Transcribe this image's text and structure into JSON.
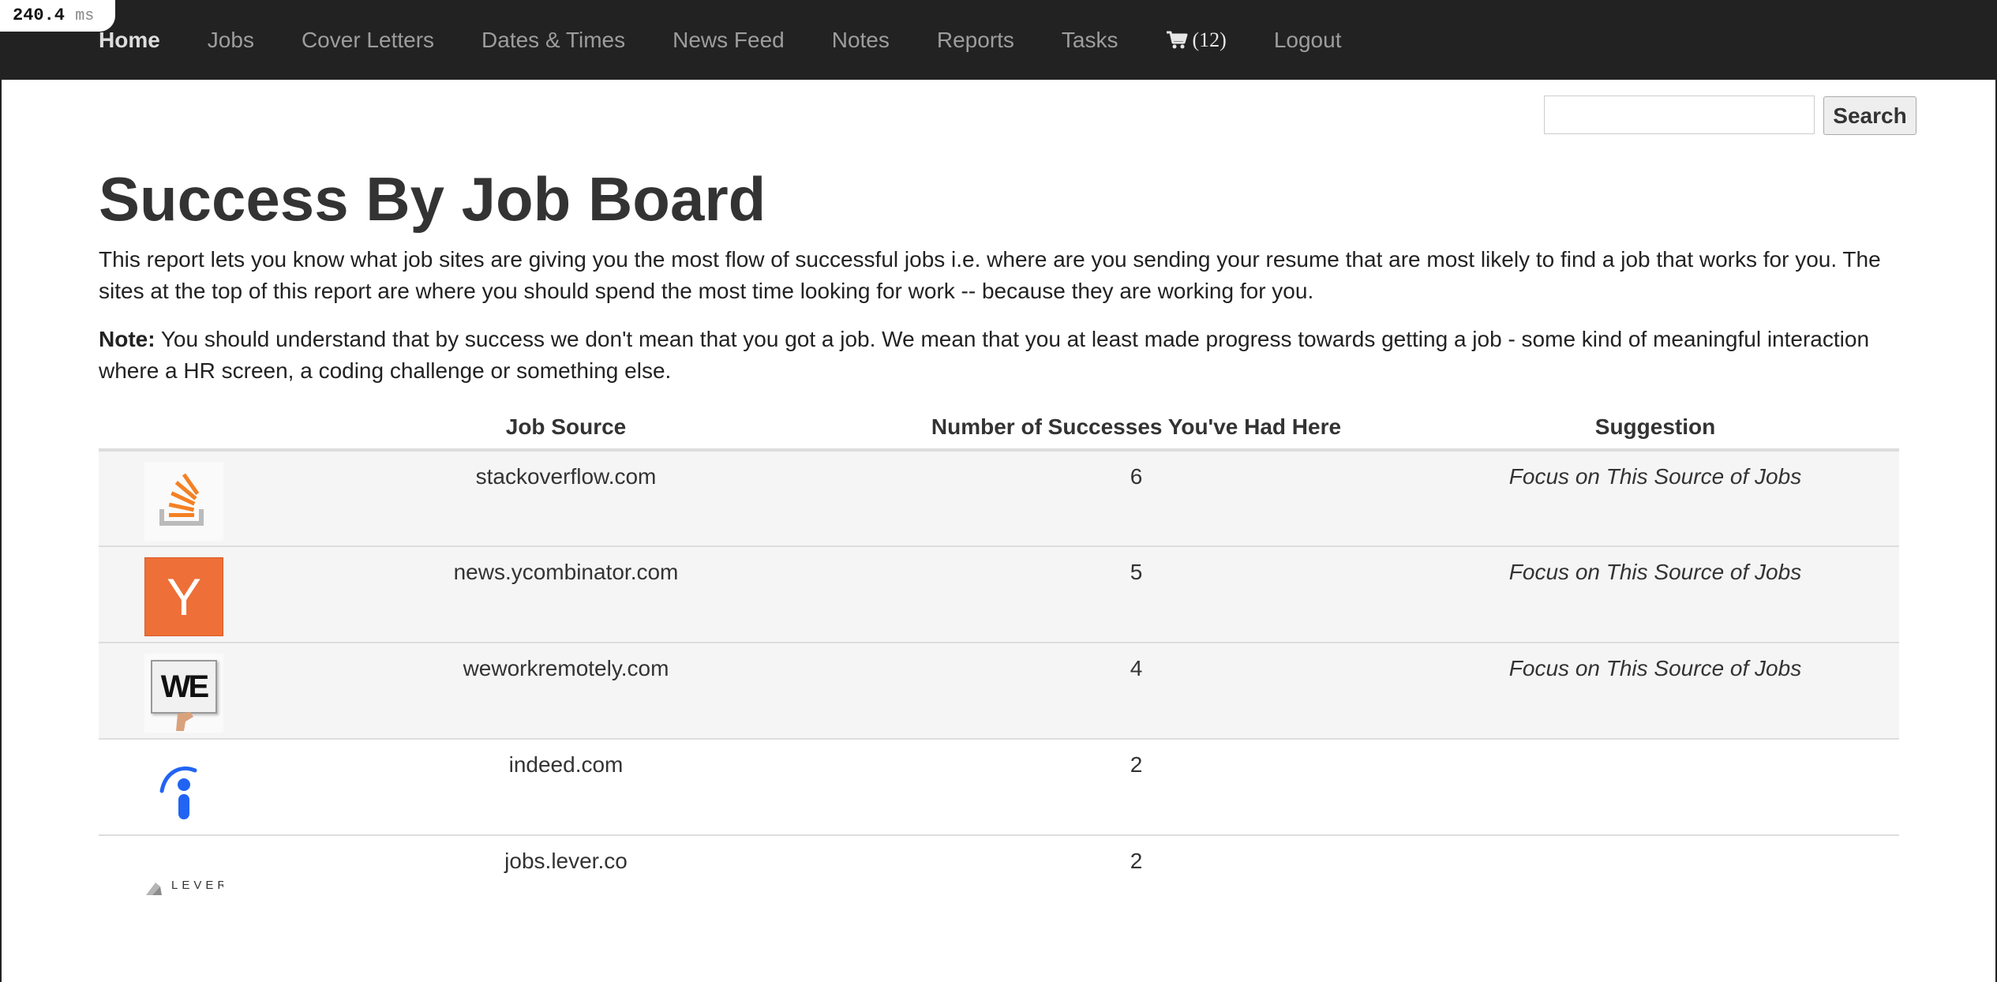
{
  "timing": {
    "value": "240.4",
    "unit": "ms"
  },
  "nav": {
    "items": [
      {
        "label": "Home",
        "active": true
      },
      {
        "label": "Jobs"
      },
      {
        "label": "Cover Letters"
      },
      {
        "label": "Dates & Times"
      },
      {
        "label": "News Feed"
      },
      {
        "label": "Notes"
      },
      {
        "label": "Reports"
      },
      {
        "label": "Tasks"
      }
    ],
    "cart": {
      "icon": "cart-icon",
      "count": "(12)"
    },
    "logout": "Logout"
  },
  "search": {
    "value": "",
    "button_label": "Search"
  },
  "page": {
    "title": "Success By Job Board",
    "intro": "This report lets you know what job sites are giving you the most flow of successful jobs i.e. where are you sending your resume that are most likely to find a job that works for you. The sites at the top of this report are where you should spend the most time looking for work -- because they are working for you.",
    "note_label": "Note:",
    "note_text": " You should understand that by success we don't mean that you got a job. We mean that you at least made progress towards getting a job - some kind of meaningful interaction where a HR screen, a coding challenge or something else."
  },
  "table": {
    "headers": [
      "",
      "Job Source",
      "Number of Successes You've Had Here",
      "Suggestion"
    ],
    "rows": [
      {
        "logo": "stackoverflow-logo",
        "source": "stackoverflow.com",
        "successes": "6",
        "suggestion": "Focus on This Source of Jobs"
      },
      {
        "logo": "ycombinator-logo",
        "source": "news.ycombinator.com",
        "successes": "5",
        "suggestion": "Focus on This Source of Jobs"
      },
      {
        "logo": "weworkremotely-logo",
        "source": "weworkremotely.com",
        "successes": "4",
        "suggestion": "Focus on This Source of Jobs"
      },
      {
        "logo": "indeed-logo",
        "source": "indeed.com",
        "successes": "2",
        "suggestion": ""
      },
      {
        "logo": "lever-logo",
        "source": "jobs.lever.co",
        "successes": "2",
        "suggestion": ""
      }
    ]
  },
  "logos": {
    "ycombinator_letter": "Y",
    "weworkremotely_text": "WE",
    "lever_text": "LEVER"
  },
  "colors": {
    "navbar": "#222222",
    "stackoverflow_orange": "#f48024",
    "ycombinator_orange": "#ee6f37",
    "indeed_blue": "#2164f3"
  }
}
